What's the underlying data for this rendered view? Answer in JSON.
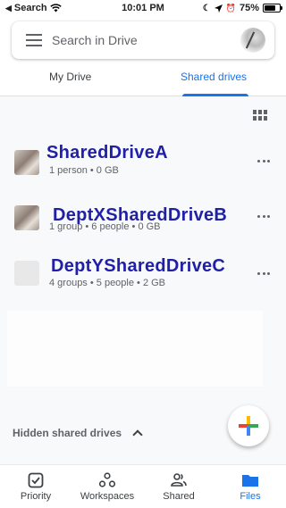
{
  "status_bar": {
    "carrier": "Search",
    "time": "10:01 PM",
    "battery": "75%",
    "battery_level": 0.75
  },
  "search": {
    "placeholder": "Search in Drive"
  },
  "tabs": [
    {
      "label": "My Drive",
      "active": false
    },
    {
      "label": "Shared drives",
      "active": true
    }
  ],
  "drives": [
    {
      "name": "SharedDriveA",
      "meta": "1 person • 0 GB",
      "thumb": "photo"
    },
    {
      "name": "DeptXSharedDriveB",
      "meta": "1 group • 6 people • 0 GB",
      "thumb": "photo"
    },
    {
      "name": "DeptYSharedDriveC",
      "meta": "4 groups • 5 people • 2 GB",
      "thumb": "blank"
    }
  ],
  "hidden_section": {
    "label": "Hidden shared drives"
  },
  "bottom_nav": [
    {
      "label": "Priority",
      "icon": "checkbox-icon",
      "active": false
    },
    {
      "label": "Workspaces",
      "icon": "workspaces-icon",
      "active": false
    },
    {
      "label": "Shared",
      "icon": "people-icon",
      "active": false
    },
    {
      "label": "Files",
      "icon": "folder-icon",
      "active": true
    }
  ],
  "colors": {
    "accent": "#1a73e8",
    "drive_name": "#1f1fa8"
  }
}
